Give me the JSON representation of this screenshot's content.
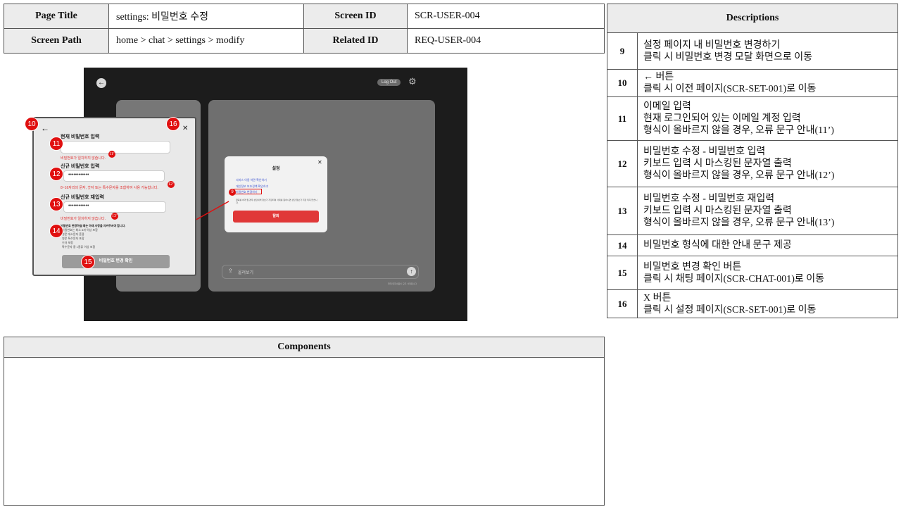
{
  "header": {
    "page_title_label": "Page Title",
    "page_title_value": "settings: 비밀번호 수정",
    "screen_id_label": "Screen ID",
    "screen_id_value": "SCR-USER-004",
    "screen_path_label": "Screen Path",
    "screen_path_value": "home > chat > settings > modify",
    "related_id_label": "Related ID",
    "related_id_value": "REQ-USER-004"
  },
  "descriptions": {
    "title": "Descriptions",
    "rows": [
      {
        "num": "9",
        "lines": [
          "설정 페이지 내 비밀번호 변경하기",
          "클릭 시 비밀번호 변경 모달 화면으로 이동"
        ]
      },
      {
        "num": "10",
        "lines": [
          "← 버튼",
          "클릭 시 이전 페이지(SCR-SET-001)로 이동"
        ]
      },
      {
        "num": "11",
        "lines": [
          "이메일 입력",
          "현재 로그인되어 있는 이메일 계정 입력",
          "형식이 올바르지 않을 경우, 오류 문구 안내(11’)"
        ]
      },
      {
        "num": "12",
        "lines": [
          "비밀번호 수정 - 비밀번호 입력",
          "키보드 입력 시 마스킹된 문자열 출력",
          "형식이 올바르지 않을 경우, 오류 문구 안내(12’)"
        ]
      },
      {
        "num": "13",
        "lines": [
          "비밀번호 수정 - 비밀번호 재입력",
          "키보드 입력 시 마스킹된 문자열 출력",
          "형식이 올바르지 않을 경우, 오류 문구 안내(13’)"
        ]
      },
      {
        "num": "14",
        "lines": [
          "비밀번호 형식에 대한 안내 문구 제공"
        ]
      },
      {
        "num": "15",
        "lines": [
          "비밀번호 변경 확인 버튼",
          "클릭 시 채팅 페이지(SCR-CHAT-001)로 이동"
        ]
      },
      {
        "num": "16",
        "lines": [
          "X 버튼",
          "클릭 시 설정 페이지(SCR-SET-001)로 이동"
        ]
      }
    ]
  },
  "components": {
    "title": "Components"
  },
  "shot": {
    "back_glyph": "←",
    "logout": "Log Out",
    "gear_glyph": "⚙",
    "settings_title": "설정",
    "settings_items": [
      "서비스 이용 약관 확인하기",
      "개인정보 보호정책 확인하기",
      "비밀번호 변경하기"
    ],
    "withdraw_note": "탈퇴를 하게 될 경우 상담내역 정보가 저장되며 삭제를 원하시면 상담 정보가 저장 되지 않습니다.",
    "withdraw_button": "탈퇴",
    "chat_placeholder": "올려보기",
    "chat_note": "현재 대화내용이 모두 삭제됩니다",
    "close_glyph": "✕",
    "send_glyph": "↑",
    "attach_glyph": "⇪"
  },
  "pw_modal": {
    "back_glyph": "←",
    "close_glyph": "✕",
    "current_label": "현재 비밀번호 입력",
    "current_error": "비밀번호가 일치하지 않습니다.",
    "new_label": "신규 비밀번호 입력",
    "new_value": "••••••••••••",
    "new_error": "8~16자리의 문자, 숫자 또는 특수문자를 조합하여 사용 가능합니다.",
    "confirm_label": "신규 비밀번호 재입력",
    "confirm_value": "••••••••••••",
    "confirm_error": "비밀번호가 일치하지 않습니다.",
    "rules_title": "비밀번호 변경하실 때는 아래 사항을 지켜주셔야 합니다.",
    "rules": [
      "비밀번호는 최소 8자 이상 포함",
      "영문 대소문자 혼용",
      "영문 특수문자 포함",
      "숫자 포함",
      "특수문자 중 1종류 이상 포함"
    ],
    "submit_label": "비밀번호 변경 확인"
  },
  "badges": {
    "b9": "9",
    "b10": "10",
    "b11": "11",
    "b12": "12",
    "b13": "13",
    "b14": "14",
    "b15": "15",
    "b16": "16",
    "b11p": "11’",
    "b12p": "12’",
    "b13p": "13’"
  },
  "colors": {
    "badge": "#e01010",
    "error": "#e03030",
    "withdraw": "#e03838",
    "link": "#3a52d0"
  }
}
